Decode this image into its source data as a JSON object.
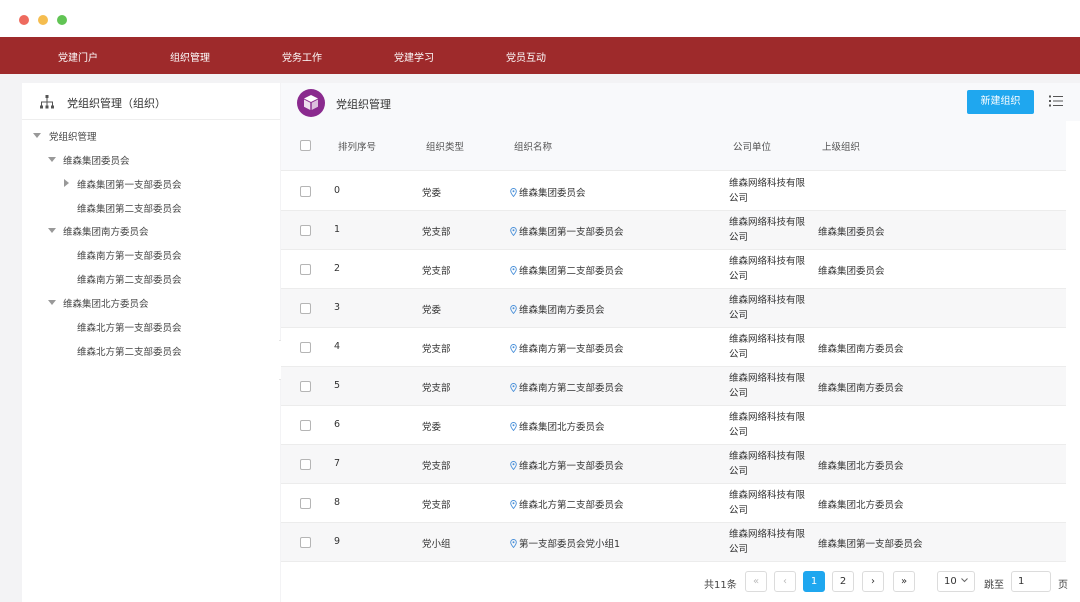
{
  "nav": {
    "items": [
      "党建门户",
      "组织管理",
      "党务工作",
      "党建学习",
      "党员互动"
    ]
  },
  "left": {
    "title": "党组织管理（组织）",
    "tree": {
      "root": "党组织管理",
      "n1": "维森集团委员会",
      "n1a": "维森集团第一支部委员会",
      "n1b": "维森集团第二支部委员会",
      "n2": "维森集团南方委员会",
      "n2a": "维森南方第一支部委员会",
      "n2b": "维森南方第二支部委员会",
      "n3": "维森集团北方委员会",
      "n3a": "维森北方第一支部委员会",
      "n3b": "维森北方第二支部委员会"
    }
  },
  "right": {
    "title": "党组织管理",
    "new_button": "新建组织"
  },
  "table": {
    "headers": [
      "排列序号",
      "组织类型",
      "组织名称",
      "公司单位",
      "上级组织"
    ],
    "rows": [
      {
        "idx": "0",
        "type": "党委",
        "name": "维森集团委员会",
        "company": "维森网络科技有限公司",
        "parent": ""
      },
      {
        "idx": "1",
        "type": "党支部",
        "name": "维森集团第一支部委员会",
        "company": "维森网络科技有限公司",
        "parent": "维森集团委员会"
      },
      {
        "idx": "2",
        "type": "党支部",
        "name": "维森集团第二支部委员会",
        "company": "维森网络科技有限公司",
        "parent": "维森集团委员会"
      },
      {
        "idx": "3",
        "type": "党委",
        "name": "维森集团南方委员会",
        "company": "维森网络科技有限公司",
        "parent": ""
      },
      {
        "idx": "4",
        "type": "党支部",
        "name": "维森南方第一支部委员会",
        "company": "维森网络科技有限公司",
        "parent": "维森集团南方委员会"
      },
      {
        "idx": "5",
        "type": "党支部",
        "name": "维森南方第二支部委员会",
        "company": "维森网络科技有限公司",
        "parent": "维森集团南方委员会"
      },
      {
        "idx": "6",
        "type": "党委",
        "name": "维森集团北方委员会",
        "company": "维森网络科技有限公司",
        "parent": ""
      },
      {
        "idx": "7",
        "type": "党支部",
        "name": "维森北方第一支部委员会",
        "company": "维森网络科技有限公司",
        "parent": "维森集团北方委员会"
      },
      {
        "idx": "8",
        "type": "党支部",
        "name": "维森北方第二支部委员会",
        "company": "维森网络科技有限公司",
        "parent": "维森集团北方委员会"
      },
      {
        "idx": "9",
        "type": "党小组",
        "name": "第一支部委员会党小组1",
        "company": "维森网络科技有限公司",
        "parent": "维森集团第一支部委员会"
      }
    ]
  },
  "pager": {
    "total": "共11条",
    "first": "«",
    "prev": "‹",
    "page1": "1",
    "page2": "2",
    "next": "›",
    "last": "»",
    "size": "10",
    "goto_label": "跳至",
    "goto_value": "1",
    "page_suffix": "页"
  },
  "colors": {
    "nav_bg": "#9e2a2b",
    "accent": "#1fa7ef",
    "cube": "#8a2a8e"
  }
}
